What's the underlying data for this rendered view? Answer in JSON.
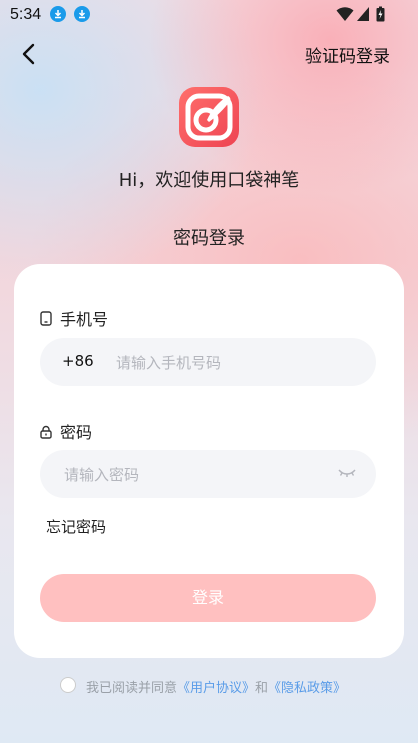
{
  "status_bar": {
    "time": "5:34"
  },
  "header": {
    "right_action": "验证码登录"
  },
  "welcome": "Hi，欢迎使用口袋神笔",
  "subtitle": "密码登录",
  "phone": {
    "label": "手机号",
    "prefix": "+86",
    "placeholder": "请输入手机号码"
  },
  "password": {
    "label": "密码",
    "placeholder": "请输入密码"
  },
  "forgot": "忘记密码",
  "login_button": "登录",
  "agreement": {
    "prefix": "我已阅读并同意",
    "user_agreement": "《用户协议》",
    "and": "和",
    "privacy_policy": "《隐私政策》"
  },
  "colors": {
    "brand": "#f2585c",
    "button_disabled": "#ffc0c0",
    "link": "#5a9ce8"
  }
}
